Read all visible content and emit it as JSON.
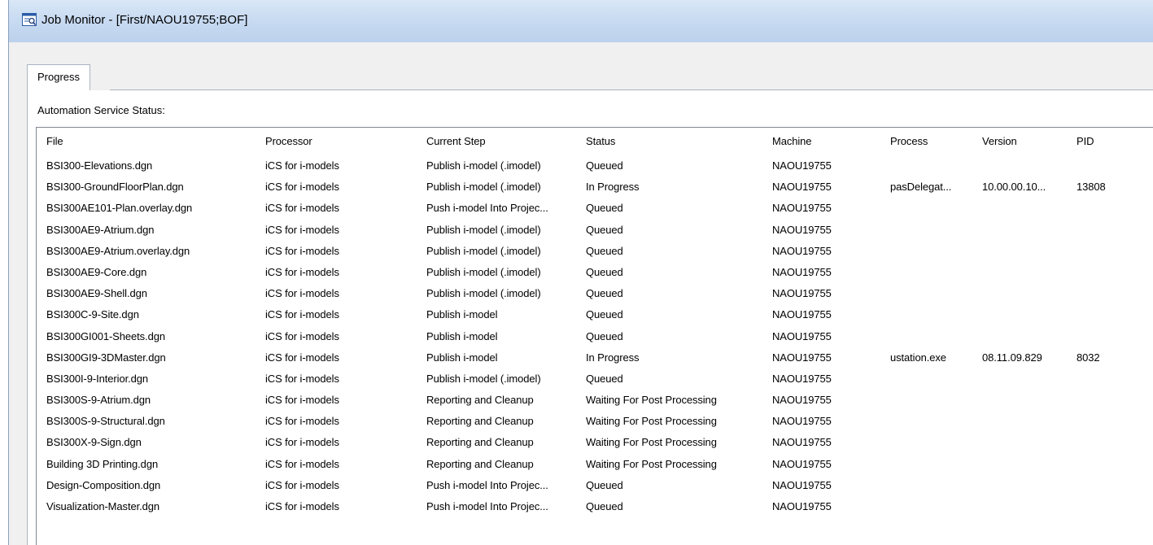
{
  "window": {
    "title": "Job Monitor -  [First/NAOU19755;BOF]"
  },
  "tabs": [
    {
      "label": "Progress"
    }
  ],
  "section_label": "Automation Service Status:",
  "table": {
    "columns": [
      "File",
      "Processor",
      "Current Step",
      "Status",
      "Machine",
      "Process",
      "Version",
      "PID"
    ],
    "rows": [
      [
        "BSI300-Elevations.dgn",
        "iCS for i-models",
        "Publish i-model (.imodel)",
        "Queued",
        "NAOU19755",
        "",
        "",
        ""
      ],
      [
        "BSI300-GroundFloorPlan.dgn",
        "iCS for i-models",
        "Publish i-model (.imodel)",
        "In Progress",
        "NAOU19755",
        "pasDelegat...",
        "10.00.00.10...",
        "13808"
      ],
      [
        "BSI300AE101-Plan.overlay.dgn",
        "iCS for i-models",
        "Push i-model Into Projec...",
        "Queued",
        "NAOU19755",
        "",
        "",
        ""
      ],
      [
        "BSI300AE9-Atrium.dgn",
        "iCS for i-models",
        "Publish i-model (.imodel)",
        "Queued",
        "NAOU19755",
        "",
        "",
        ""
      ],
      [
        "BSI300AE9-Atrium.overlay.dgn",
        "iCS for i-models",
        "Publish i-model (.imodel)",
        "Queued",
        "NAOU19755",
        "",
        "",
        ""
      ],
      [
        "BSI300AE9-Core.dgn",
        "iCS for i-models",
        "Publish i-model (.imodel)",
        "Queued",
        "NAOU19755",
        "",
        "",
        ""
      ],
      [
        "BSI300AE9-Shell.dgn",
        "iCS for i-models",
        "Publish i-model (.imodel)",
        "Queued",
        "NAOU19755",
        "",
        "",
        ""
      ],
      [
        "BSI300C-9-Site.dgn",
        "iCS for i-models",
        "Publish i-model",
        "Queued",
        "NAOU19755",
        "",
        "",
        ""
      ],
      [
        "BSI300GI001-Sheets.dgn",
        "iCS for i-models",
        "Publish i-model",
        "Queued",
        "NAOU19755",
        "",
        "",
        ""
      ],
      [
        "BSI300GI9-3DMaster.dgn",
        "iCS for i-models",
        "Publish i-model",
        "In Progress",
        "NAOU19755",
        "ustation.exe",
        "08.11.09.829",
        "8032"
      ],
      [
        "BSI300I-9-Interior.dgn",
        "iCS for i-models",
        "Publish i-model (.imodel)",
        "Queued",
        "NAOU19755",
        "",
        "",
        ""
      ],
      [
        "BSI300S-9-Atrium.dgn",
        "iCS for i-models",
        "Reporting and Cleanup",
        "Waiting For Post Processing",
        "NAOU19755",
        "",
        "",
        ""
      ],
      [
        "BSI300S-9-Structural.dgn",
        "iCS for i-models",
        "Reporting and Cleanup",
        "Waiting For Post Processing",
        "NAOU19755",
        "",
        "",
        ""
      ],
      [
        "BSI300X-9-Sign.dgn",
        "iCS for i-models",
        "Reporting and Cleanup",
        "Waiting For Post Processing",
        "NAOU19755",
        "",
        "",
        ""
      ],
      [
        "Building 3D Printing.dgn",
        "iCS for i-models",
        "Reporting and Cleanup",
        "Waiting For Post Processing",
        "NAOU19755",
        "",
        "",
        ""
      ],
      [
        "Design-Composition.dgn",
        "iCS for i-models",
        "Push i-model Into Projec...",
        "Queued",
        "NAOU19755",
        "",
        "",
        ""
      ],
      [
        "Visualization-Master.dgn",
        "iCS for i-models",
        "Push i-model Into Projec...",
        "Queued",
        "NAOU19755",
        "",
        "",
        ""
      ]
    ]
  },
  "icons": {
    "app": "job-monitor-icon"
  },
  "colors": {
    "titlebar": "#c6d9f1",
    "window_bg": "#f0f0f0",
    "list_bg": "#ffffff"
  }
}
